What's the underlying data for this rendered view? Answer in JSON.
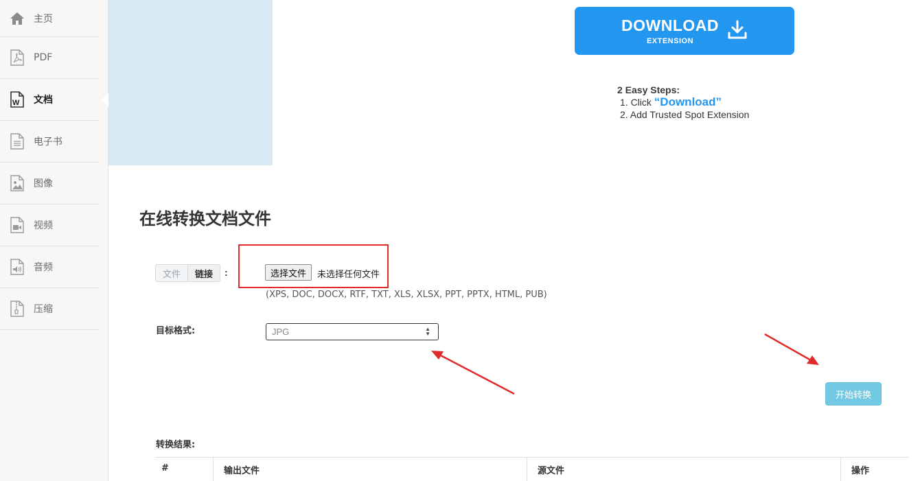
{
  "sidebar": {
    "items": [
      {
        "label": "主页",
        "icon": "home-icon"
      },
      {
        "label": "PDF",
        "icon": "pdf-file-icon"
      },
      {
        "label": "文档",
        "icon": "word-document-icon",
        "active": true
      },
      {
        "label": "电子书",
        "icon": "ebook-file-icon"
      },
      {
        "label": "图像",
        "icon": "image-file-icon"
      },
      {
        "label": "视频",
        "icon": "video-file-icon"
      },
      {
        "label": "音频",
        "icon": "audio-file-icon"
      },
      {
        "label": "压缩",
        "icon": "archive-file-icon"
      }
    ]
  },
  "download_banner": {
    "title": "DOWNLOAD",
    "subtitle": "EXTENSION",
    "steps_heading": "2 Easy Steps:",
    "step1_prefix": "1. Click ",
    "step1_highlight": "“Download”",
    "step2": "2. Add Trusted Spot Extension",
    "color": "#2396f0"
  },
  "main": {
    "title": "在线转换文档文件",
    "tabs": [
      "文件",
      "链接"
    ],
    "colon": ":",
    "file_button": "选择文件",
    "file_status": "未选择任何文件",
    "formats": "(XPS, DOC, DOCX, RTF, TXT, XLS, XLSX, PPT, PPTX, HTML, PUB)",
    "target_label": "目标格式:",
    "target_value": "JPG",
    "start_button": "开始转换",
    "result_label": "转换结果:",
    "result_columns": [
      "#",
      "输出文件",
      "源文件",
      "操作"
    ]
  },
  "colors": {
    "annotation_red": "#e02b2b",
    "start_button": "#5bc0de"
  }
}
